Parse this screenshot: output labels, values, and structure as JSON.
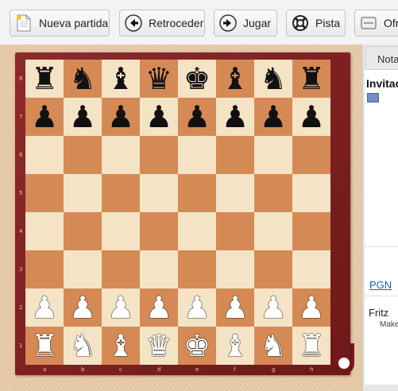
{
  "toolbar": {
    "buttons": [
      {
        "label": "Nueva partida",
        "icon": "new-document-icon"
      },
      {
        "label": "Retroceder",
        "icon": "arrow-left-icon"
      },
      {
        "label": "Jugar",
        "icon": "arrow-right-icon"
      },
      {
        "label": "Pista",
        "icon": "lifebuoy-icon"
      },
      {
        "label": "Ofre",
        "icon": "offer-icon"
      }
    ]
  },
  "board": {
    "ranks": [
      "8",
      "7",
      "6",
      "5",
      "4",
      "3",
      "2",
      "1"
    ],
    "files": [
      "a",
      "b",
      "c",
      "d",
      "e",
      "f",
      "g",
      "h"
    ],
    "position": [
      [
        "r",
        "n",
        "b",
        "q",
        "k",
        "b",
        "n",
        "r"
      ],
      [
        "p",
        "p",
        "p",
        "p",
        "p",
        "p",
        "p",
        "p"
      ],
      [
        "",
        "",
        "",
        "",
        "",
        "",
        "",
        ""
      ],
      [
        "",
        "",
        "",
        "",
        "",
        "",
        "",
        ""
      ],
      [
        "",
        "",
        "",
        "",
        "",
        "",
        "",
        ""
      ],
      [
        "",
        "",
        "",
        "",
        "",
        "",
        "",
        ""
      ],
      [
        "P",
        "P",
        "P",
        "P",
        "P",
        "P",
        "P",
        "P"
      ],
      [
        "R",
        "N",
        "B",
        "Q",
        "K",
        "B",
        "N",
        "R"
      ]
    ],
    "colors": {
      "light": "#f4e3c4",
      "dark": "#d58a55",
      "frame": "#7a1c1e"
    }
  },
  "panel": {
    "tab_label": "Nota",
    "heading": "Invitac",
    "pgn_link": "PGN",
    "player_name": "Fritz",
    "player_sub": "Make"
  }
}
